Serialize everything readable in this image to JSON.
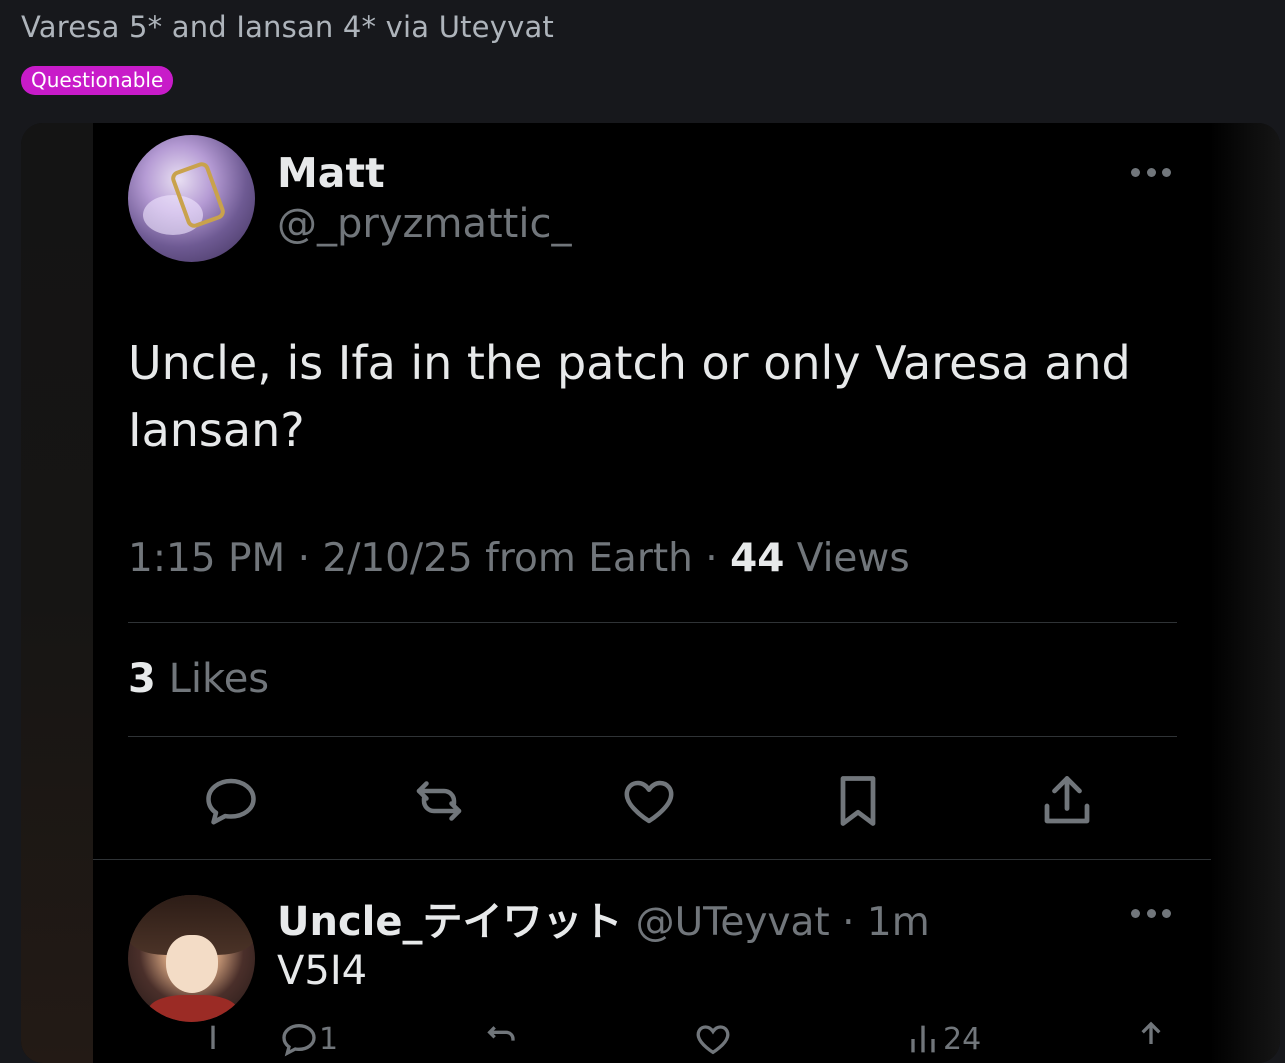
{
  "post": {
    "title": "Varesa 5* and Iansan 4* via Uteyvat",
    "rating": "Questionable"
  },
  "tweet": {
    "display_name": "Matt",
    "handle": "@_pryzmattic_",
    "text": "Uncle, is Ifa in the patch or only Varesa and Iansan?",
    "time": "1:15 PM",
    "sep1": "·",
    "date_location": "2/10/25 from Earth",
    "sep2": "·",
    "views_count": "44",
    "views_label": "Views",
    "likes_count": "3",
    "likes_label": "Likes"
  },
  "actions": {
    "reply": "reply-icon",
    "retweet": "retweet-icon",
    "like": "heart-icon",
    "bookmark": "bookmark-icon",
    "share": "share-icon"
  },
  "reply": {
    "display_name": "Uncle_テイワット",
    "handle_time": "@UTeyvat · 1m",
    "text": "V5I4",
    "reply_count": "1",
    "views_count": "24"
  },
  "colors": {
    "background": "#17181c",
    "badge": "#c81bc9",
    "tweet_bg": "#000000",
    "muted": "#71767b",
    "text": "#e7e9ea"
  }
}
